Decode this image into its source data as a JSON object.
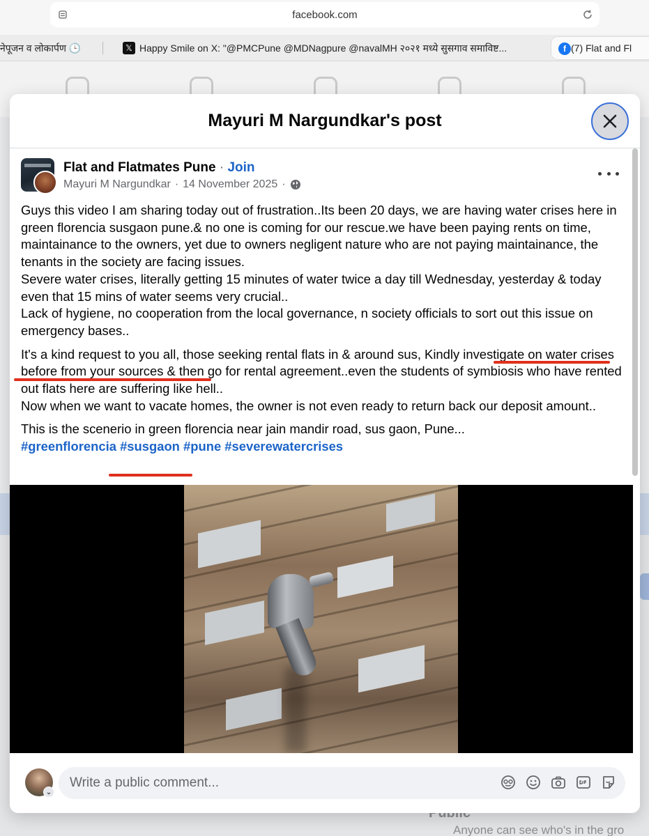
{
  "browser": {
    "url": "facebook.com",
    "tabs": [
      {
        "label": "नेपूजन व लोकार्पण 🕒"
      },
      {
        "label": "Happy Smile on X: \"@PMCPune @MDNagpure @navalMH २०२१ मध्ये सुसगाव समाविष्ट..."
      },
      {
        "label": "(7) Flat and Fl"
      }
    ]
  },
  "background": {
    "public_label": "Public",
    "public_sub": "Anyone can see who's in the gro"
  },
  "modal": {
    "title": "Mayuri M Nargundkar's post",
    "close_icon": "close-icon"
  },
  "post": {
    "group_name": "Flat and Flatmates Pune",
    "separator": " · ",
    "join_label": "Join",
    "author": "Mayuri M Nargundkar",
    "date": "14 November 2025",
    "privacy_icon": "globe-icon",
    "paragraphs": [
      [
        "Guys this video I am sharing today out of frustration..Its been 20 days, we are having water crises here in green florencia susgaon pune.& no one is coming for our rescue.we have been paying rents on time, maintainance to the owners, yet due to owners negligent  nature who are not paying maintainance, the tenants in the society are facing issues.",
        "Severe water crises, literally getting 15 minutes of water twice a day till Wednesday, yesterday & today even that 15 mins of water seems very crucial..",
        "Lack of hygiene, no cooperation from the local governance, n society officials to sort out this issue on emergency bases.."
      ],
      [
        "It's a kind request to you all, those seeking rental flats in & around sus, Kindly investigate on water crises before from your sources & then go for rental agreement..even the students of symbiosis who have rented out flats here are suffering like hell..",
        "Now when we want to vacate homes, the owner is not even ready to return back our deposit amount.."
      ],
      [
        "This is the scenerio in green florencia near jain mandir road, sus gaon, Pune..."
      ]
    ],
    "hashtags": "#greenflorencia #susgaon #pune #severewatercrises"
  },
  "comment": {
    "placeholder": "Write a public comment...",
    "icons": [
      "avatar-sticker-icon",
      "emoji-icon",
      "camera-icon",
      "gif-icon",
      "sticker-icon"
    ]
  },
  "colors": {
    "accent": "#1c64c8",
    "underline": "#e0301e",
    "close_ring": "#3a6fd8"
  }
}
